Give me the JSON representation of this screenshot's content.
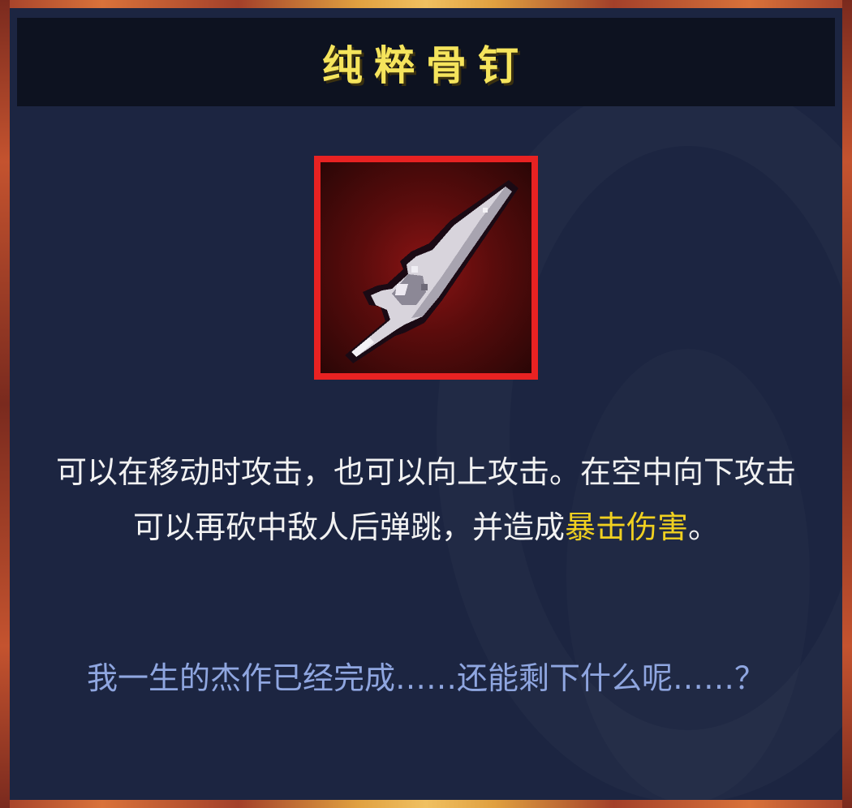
{
  "item": {
    "title": "纯粹骨钉",
    "icon": "pure-nail-icon"
  },
  "description": {
    "part1": "可以在移动时攻击，也可以向上攻击。在空中向下攻击可以再砍中敌人后弹跳，并造成",
    "highlight": "暴击伤害",
    "part2": "。"
  },
  "quote": {
    "text": "我一生的杰作已经完成……还能剩下什么呢……？"
  },
  "colors": {
    "title": "#f5e45c",
    "highlight": "#f0d020",
    "quote": "#8fa6e0",
    "icon_border": "#e82222",
    "panel_bg": "#1c2541"
  }
}
